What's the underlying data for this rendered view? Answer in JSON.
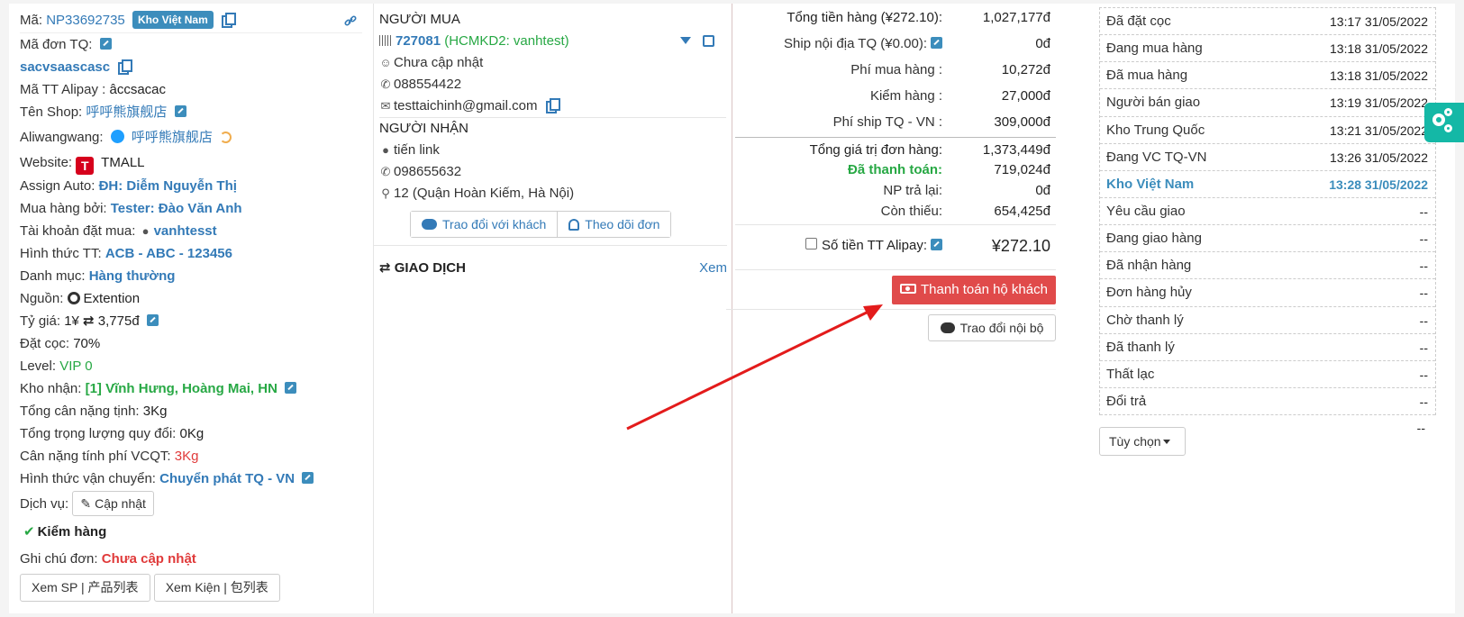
{
  "order": {
    "ma_label": "Mã:",
    "ma_value": "NP33692735",
    "warehouse_badge": "Kho Việt Nam",
    "ma_don_tq_label": "Mã đơn TQ:",
    "ma_don_tq_value": "sacvsaascasc",
    "alipay_label": "Mã TT Alipay :",
    "alipay_value": "âccsacac",
    "shop_label": "Tên Shop:",
    "shop_value": "呼呼熊旗舰店",
    "aliwangwang_label": "Aliwangwang:",
    "aliwangwang_value": "呼呼熊旗舰店",
    "website_label": "Website:",
    "website_icon_text": "T",
    "website_value": "TMALL",
    "assign_label": "Assign Auto:",
    "assign_value": "ĐH: Diễm Nguyễn Thị",
    "mua_boi_label": "Mua hàng bởi:",
    "mua_boi_value": "Tester: Đào Văn Anh",
    "tk_label": "Tài khoản đặt mua:",
    "tk_value": "vanhtesst",
    "httt_label": "Hình thức TT:",
    "httt_value": "ACB - ABC - 123456",
    "danh_muc_label": "Danh mục:",
    "danh_muc_value": "Hàng thường",
    "nguon_label": "Nguồn:",
    "nguon_value": "Extention",
    "ty_gia_label": "Tỷ giá:",
    "ty_gia_left": "1¥",
    "ty_gia_right": "3,775đ",
    "dat_coc_label": "Đặt cọc:",
    "dat_coc_value": "70%",
    "level_label": "Level:",
    "level_value": "VIP 0",
    "kho_nhan_label": "Kho nhận:",
    "kho_nhan_value": "[1] Vĩnh Hưng, Hoàng Mai, HN",
    "can_nang_label": "Tổng cân nặng tịnh:",
    "can_nang_value": "3Kg",
    "quy_doi_label": "Tổng trọng lượng quy đổi:",
    "quy_doi_value": "0Kg",
    "vcqt_label": "Cân nặng tính phí VCQT:",
    "vcqt_value": "3Kg",
    "vc_label": "Hình thức vận chuyển:",
    "vc_value": "Chuyển phát TQ - VN",
    "dich_vu_label": "Dịch vụ:",
    "cap_nhat_btn": "Cập nhật",
    "kiem_hang": "Kiểm hàng",
    "ghi_chu_label": "Ghi chú đơn:",
    "ghi_chu_value": "Chưa cập nhật",
    "xem_sp_btn": "Xem SP | 产品列表",
    "xem_kien_btn": "Xem Kiện | 包列表"
  },
  "buyer": {
    "title": "NGƯỜI MUA",
    "code": "727081",
    "code_note": "(HCMKD2: vanhtest)",
    "name": "Chưa cập nhật",
    "phone": "088554422",
    "email": "testtaichinh@gmail.com"
  },
  "receiver": {
    "title": "NGƯỜI NHẬN",
    "name": "tiến link",
    "phone": "098655632",
    "address": "12 (Quận Hoàn Kiếm, Hà Nội)",
    "chat_btn": "Trao đổi với khách",
    "follow_btn": "Theo dõi đơn"
  },
  "transactions": {
    "title": "GIAO DỊCH",
    "view": "Xem"
  },
  "summary": {
    "tong_tien_label": "Tổng tiền hàng (¥272.10):",
    "tong_tien_value": "1,027,177đ",
    "ship_label": "Ship nội địa TQ (¥0.00):",
    "ship_value": "0đ",
    "phi_mua_label": "Phí mua hàng :",
    "phi_mua_value": "10,272đ",
    "kiem_hang_label": "Kiểm hàng :",
    "kiem_hang_value": "27,000đ",
    "phi_ship_label": "Phí ship TQ - VN :",
    "phi_ship_value": "309,000đ",
    "tong_gt_label": "Tổng giá trị đơn hàng:",
    "tong_gt_value": "1,373,449đ",
    "da_tt_label": "Đã thanh toán:",
    "da_tt_value": "719,024đ",
    "np_label": "NP trả lại:",
    "np_value": "0đ",
    "con_thieu_label": "Còn thiếu:",
    "con_thieu_value": "654,425đ",
    "alipay_label": "Số tiền TT Alipay:",
    "alipay_value": "¥272.10",
    "pay_btn": "Thanh toán hộ khách",
    "internal_btn": "Trao đổi nội bộ"
  },
  "timeline": [
    {
      "label": "Đã đặt cọc",
      "time": "13:17 31/05/2022"
    },
    {
      "label": "Đang mua hàng",
      "time": "13:18 31/05/2022"
    },
    {
      "label": "Đã mua hàng",
      "time": "13:18 31/05/2022"
    },
    {
      "label": "Người bán giao",
      "time": "13:19 31/05/2022"
    },
    {
      "label": "Kho Trung Quốc",
      "time": "13:21 31/05/2022"
    },
    {
      "label": "Đang VC TQ-VN",
      "time": "13:26 31/05/2022"
    },
    {
      "label": "Kho Việt Nam",
      "time": "13:28 31/05/2022"
    },
    {
      "label": "Yêu cầu giao",
      "time": "--"
    },
    {
      "label": "Đang giao hàng",
      "time": "--"
    },
    {
      "label": "Đã nhận hàng",
      "time": "--"
    },
    {
      "label": "Đơn hàng hủy",
      "time": "--"
    },
    {
      "label": "Chờ thanh lý",
      "time": "--"
    },
    {
      "label": "Đã thanh lý",
      "time": "--"
    },
    {
      "label": "Thất lạc",
      "time": "--"
    },
    {
      "label": "Đổi trả",
      "time": "--"
    }
  ],
  "timeline_tail": "--",
  "options_btn": "Tùy chọn",
  "colors": {
    "link": "#337ab7",
    "green": "#27a844",
    "red": "#e03a3a",
    "pay_button": "#e04a4a",
    "highlight": "#3c8dbc",
    "arrow": "#e31b1b",
    "settings": "#14b8a6"
  }
}
